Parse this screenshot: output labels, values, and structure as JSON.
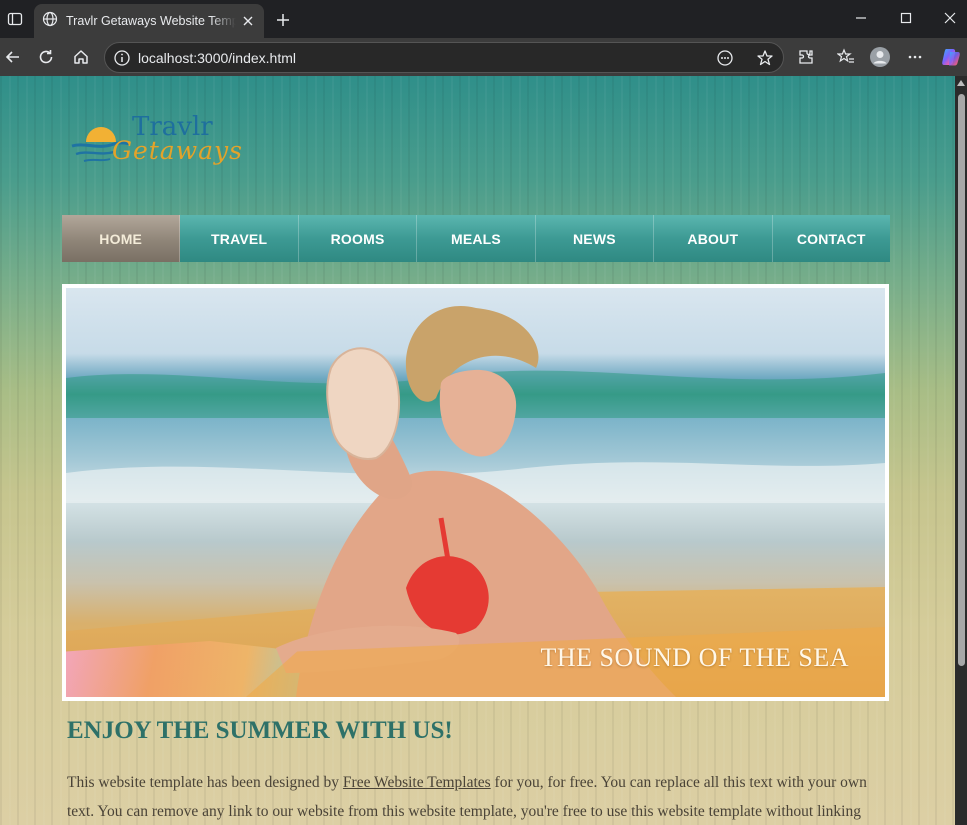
{
  "browser": {
    "tab_title": "Travlr Getaways Website Template",
    "url": "localhost:3000/index.html",
    "icons": [
      "sidebar-icon",
      "globe-icon",
      "close-icon",
      "plus-icon",
      "minimize-icon",
      "maximize-icon",
      "close-window-icon",
      "back-icon",
      "reload-icon",
      "home-icon",
      "info-icon",
      "reader-icon",
      "star-icon",
      "extensions-icon",
      "favorites-icon",
      "profile-icon",
      "more-icon",
      "copilot-icon"
    ]
  },
  "site": {
    "logo": {
      "top": "Travlr",
      "bottom": "Getaways"
    },
    "nav": [
      {
        "label": "Home",
        "active": true
      },
      {
        "label": "Travel",
        "active": false
      },
      {
        "label": "Rooms",
        "active": false
      },
      {
        "label": "Meals",
        "active": false
      },
      {
        "label": "News",
        "active": false
      },
      {
        "label": "About",
        "active": false
      },
      {
        "label": "Contact",
        "active": false
      }
    ],
    "hero_caption": "The sound of the sea",
    "headline": "Enjoy the summer with us!",
    "body": {
      "before_link": "This website template has been designed by ",
      "link": "Free Website Templates",
      "after_link": " for you, for free. You can replace all this text with your own text. You can remove any link to our website from this website template, you're free to use this website template without linking"
    },
    "colors": {
      "nav_teal": "#3d9a94",
      "nav_active": "#8f8578",
      "headline": "#2e7168",
      "logo_blue": "#1e6f9e",
      "logo_gold": "#e3a32a"
    }
  }
}
